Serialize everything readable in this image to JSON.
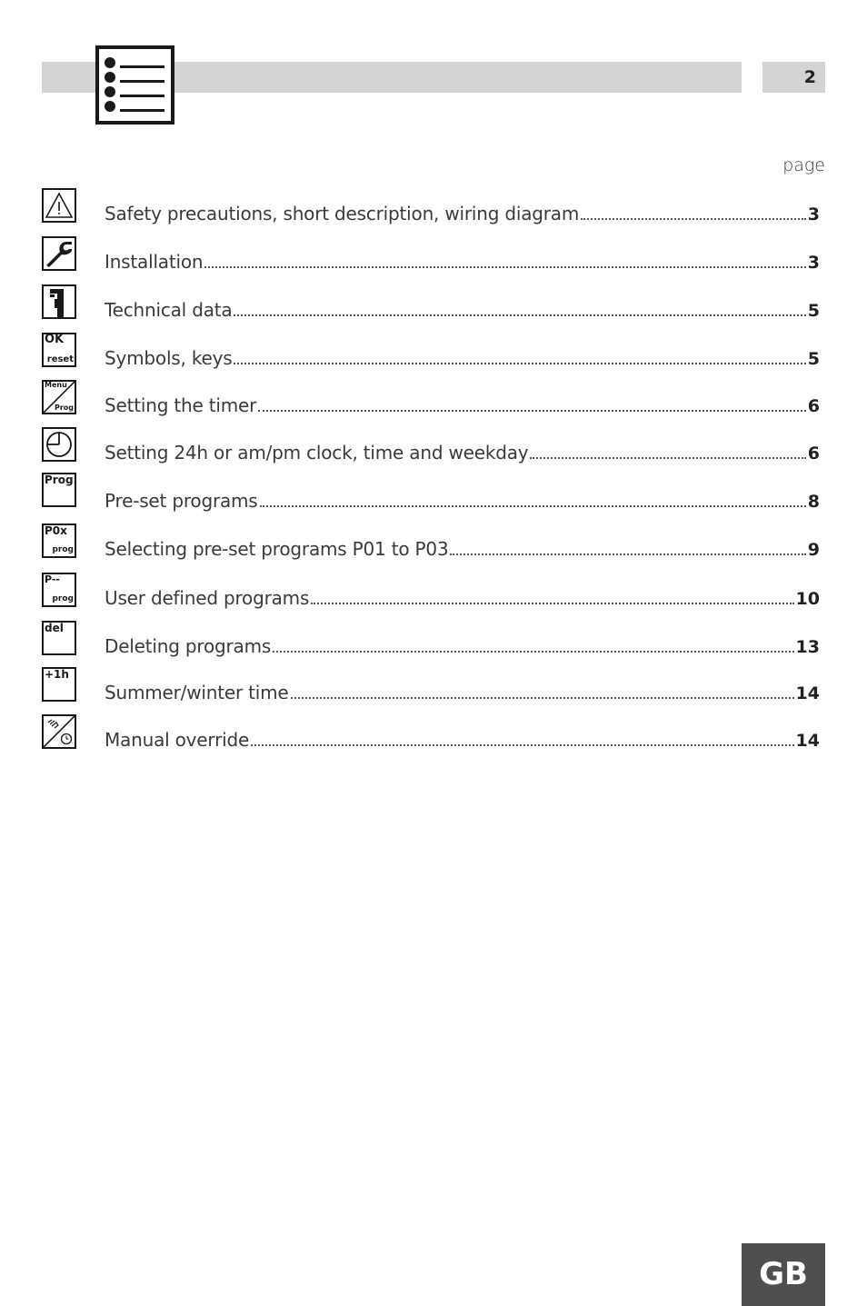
{
  "header": {
    "page_number": "2",
    "toc_icon": "list-icon"
  },
  "column_label": "page",
  "toc": [
    {
      "title": "Safety precautions, short description, wiring diagram",
      "page": "3",
      "icon": "warning-icon"
    },
    {
      "title": "Installation",
      "page": "3",
      "icon": "wrench-icon"
    },
    {
      "title": "Technical data",
      "page": "5",
      "icon": "caliper-icon"
    },
    {
      "title": "Symbols, keys",
      "page": "5",
      "icon": "ok-reset-icon",
      "icon_text": [
        "OK",
        "reset"
      ]
    },
    {
      "title": "Setting the timer",
      "page": "6",
      "icon": "menu-prog-icon",
      "icon_text": [
        "Menu",
        "Prog"
      ]
    },
    {
      "title": "Setting 24h or am/pm clock, time and weekday",
      "page": "6",
      "icon": "clock-icon"
    },
    {
      "title": "Pre-set programs",
      "page": "8",
      "icon": "prog-icon",
      "icon_text": [
        "Prog."
      ]
    },
    {
      "title": "Selecting pre-set programs P01 to P03",
      "page": "9",
      "icon": "p0x-prog-icon",
      "icon_text": [
        "P0x",
        "prog"
      ]
    },
    {
      "title": "User defined programs",
      "page": "10",
      "icon": "p-prog-icon",
      "icon_text": [
        "P--",
        "prog"
      ]
    },
    {
      "title": "Deleting programs",
      "page": "13",
      "icon": "delete-icon",
      "icon_text": [
        "del"
      ]
    },
    {
      "title": "Summer/winter time",
      "page": "14",
      "icon": "plus-1h-icon",
      "icon_text": [
        "+1h"
      ]
    },
    {
      "title": "Manual override",
      "page": "14",
      "icon": "hand-clock-icon"
    }
  ],
  "footer": {
    "language": "GB"
  }
}
